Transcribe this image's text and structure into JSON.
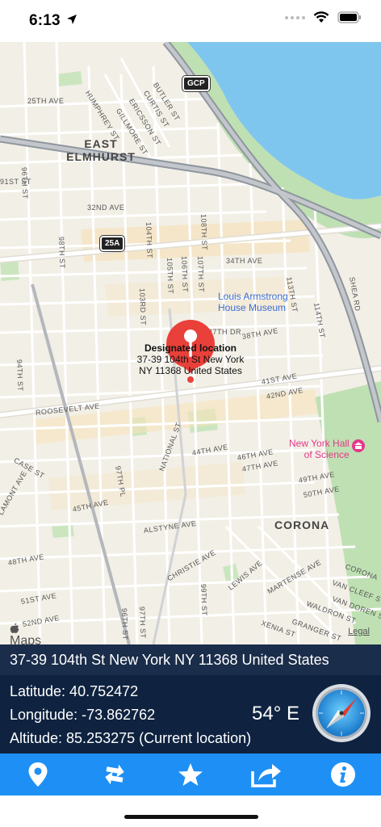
{
  "status_bar": {
    "time": "6:13"
  },
  "map": {
    "neighborhoods": [
      "EAST\nELMHURST",
      "CORONA"
    ],
    "streets": {
      "s25th": "25TH AVE",
      "humphrey": "HUMPHREY ST",
      "gillmore": "GILLMORE ST",
      "ericsson": "ERICSSON ST",
      "curtis": "CURTIS ST",
      "butler": "BUTLER ST",
      "st96": "96TH ST",
      "st91": "91ST ST",
      "ave32": "32ND AVE",
      "st98": "98TH ST",
      "st104": "104TH ST",
      "st105": "105TH ST",
      "st106": "106TH ST",
      "st107": "107TH ST",
      "st108": "108TH ST",
      "ave34": "34TH AVE",
      "st103rd": "103RD ST",
      "dr37": "37TH DR",
      "ave38": "38TH AVE",
      "st113": "113TH ST",
      "st114": "114TH ST",
      "shea": "SHEA RD",
      "st94": "94TH ST",
      "roosevelt": "ROOSEVELT AVE",
      "ave41": "41ST AVE",
      "ave42": "42ND AVE",
      "case": "CASE ST",
      "lamont": "LAMONT AVE",
      "pl97": "97TH PL",
      "national": "NATIONAL ST",
      "ave44": "44TH AVE",
      "ave46": "46TH AVE",
      "ave47": "47TH AVE",
      "ave49": "49TH AVE",
      "ave50": "50TH AVE",
      "ave45": "45TH AVE",
      "alstyne": "ALSTYNE AVE",
      "ave48": "48TH AVE",
      "christie": "CHRISTIE AVE",
      "st99": "99TH ST",
      "lewis": "LEWIS AVE",
      "martense": "MARTENSE AVE",
      "corona_ave": "CORONA",
      "vancleef": "VAN CLEEF S",
      "vandoren": "VAN DOREN S",
      "waldron": "WALDRON ST",
      "granger": "GRANGER ST",
      "xenia": "XENIA ST",
      "ave51": "51ST AVE",
      "st96b": "96TH ST",
      "st97": "97TH ST",
      "ave52": "52ND AVE"
    },
    "shields": {
      "gcp": "GCP",
      "r25a": "25A"
    },
    "pois": {
      "armstrong": "Louis Armstrong\nHouse Museum",
      "hall": "New York Hall\nof Science"
    },
    "callout": {
      "title": "Designated location",
      "address": "37-39 104th St New York\nNY 11368 United States"
    },
    "attribution": {
      "logo": "Maps",
      "legal": "Legal"
    }
  },
  "location": {
    "address": "37-39 104th St New York NY 11368 United States",
    "latitude": "Latitude: 40.752472",
    "longitude": "Longitude: -73.862762",
    "altitude": "Altitude: 85.253275 (Current location)",
    "heading": "54° E"
  },
  "toolbar": {
    "buttons": [
      "location-pin-icon",
      "swap-arrows-icon",
      "star-icon",
      "share-icon",
      "info-icon"
    ]
  },
  "colors": {
    "accent": "#1e90f5",
    "panel": "#0f2340",
    "address_bar": "#1a2d4a",
    "pin": "#e9403a"
  }
}
